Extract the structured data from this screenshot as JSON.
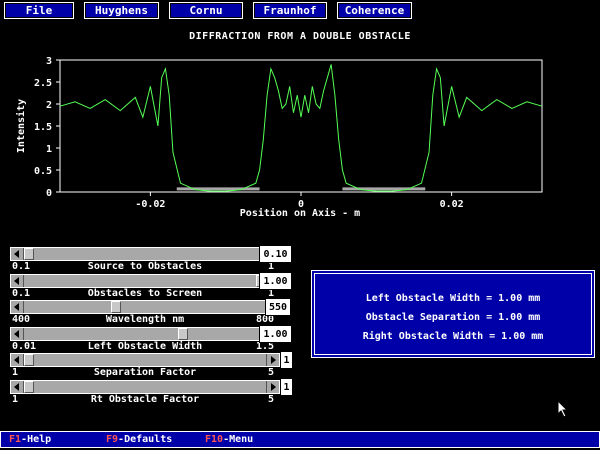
{
  "menu": [
    "File",
    "Huyghens",
    "Cornu",
    "Fraunhof",
    "Coherence"
  ],
  "chart_title": "DIFFRACTION FROM A DOUBLE OBSTACLE",
  "chart_data": {
    "type": "line",
    "title": "DIFFRACTION FROM A DOUBLE OBSTACLE",
    "xlabel": "Position on Axis - m",
    "ylabel": "Intensity",
    "xlim": [
      -0.032,
      0.032
    ],
    "ylim": [
      0,
      3
    ],
    "xticks": [
      -0.02,
      0,
      0.02
    ],
    "xtick_labels": [
      "-0.02",
      "0",
      "0.02"
    ],
    "yticks": [
      0,
      0.5,
      1,
      1.5,
      2,
      2.5,
      3
    ],
    "ytick_labels": [
      "0",
      "0.5",
      "1",
      "1.5",
      "2",
      "2.5",
      "3"
    ],
    "line_color": "#55ff55",
    "shadow_color": "#a8a8a8",
    "obstacle_shadows": [
      [
        -0.0165,
        -0.0055
      ],
      [
        0.0055,
        0.0165
      ]
    ],
    "series": [
      {
        "x": [
          -0.032,
          -0.03,
          -0.028,
          -0.026,
          -0.024,
          -0.022,
          -0.021,
          -0.02,
          -0.019,
          -0.0185,
          -0.018,
          -0.0175,
          -0.017,
          -0.016,
          -0.014,
          -0.012,
          -0.01,
          -0.008,
          -0.006,
          -0.0055,
          -0.005,
          -0.0045,
          -0.004,
          -0.0035,
          -0.003,
          -0.0025,
          -0.002,
          -0.0015,
          -0.001,
          -0.0005,
          0,
          0.0005,
          0.001,
          0.0015,
          0.002,
          0.0025,
          0.003,
          0.0035,
          0.004,
          0.0045,
          0.005,
          0.0055,
          0.006,
          0.008,
          0.01,
          0.012,
          0.014,
          0.016,
          0.017,
          0.0175,
          0.018,
          0.0185,
          0.019,
          0.02,
          0.021,
          0.022,
          0.024,
          0.026,
          0.028,
          0.03,
          0.032
        ],
        "y": [
          1.95,
          2.05,
          1.9,
          2.1,
          1.85,
          2.15,
          1.7,
          2.4,
          1.5,
          2.6,
          2.8,
          2.2,
          0.9,
          0.2,
          0.05,
          0.02,
          0.02,
          0.05,
          0.2,
          0.5,
          1.2,
          2.2,
          2.8,
          2.6,
          2.3,
          1.9,
          2.0,
          2.4,
          1.8,
          2.2,
          1.7,
          2.2,
          1.8,
          2.4,
          2.0,
          1.9,
          2.3,
          2.6,
          2.9,
          2.2,
          1.2,
          0.5,
          0.2,
          0.05,
          0.02,
          0.02,
          0.05,
          0.2,
          0.9,
          2.2,
          2.8,
          2.6,
          1.5,
          2.4,
          1.7,
          2.15,
          1.85,
          2.1,
          1.9,
          2.05,
          1.95
        ]
      }
    ]
  },
  "sliders": [
    {
      "name": "Source to Obstacles",
      "min": "0.1",
      "max": "1",
      "value": "0.10",
      "pos": 0.0
    },
    {
      "name": "Obstacles to Screen",
      "min": "0.1",
      "max": "1",
      "value": "1.00",
      "pos": 1.0
    },
    {
      "name": "Wavelength nm",
      "min": "400",
      "max": "800",
      "value": "550",
      "pos": 0.375
    },
    {
      "name": "Left Obstacle Width",
      "min": "0.01",
      "max": "1.5",
      "value": "1.00",
      "pos": 0.664
    },
    {
      "name": "Separation Factor",
      "min": "1",
      "max": "5",
      "value": "1",
      "pos": 0.0
    },
    {
      "name": "Rt Obstacle Factor",
      "min": "1",
      "max": "5",
      "value": "1",
      "pos": 0.0
    }
  ],
  "info": {
    "left_width": "Left Obstacle Width = 1.00 mm",
    "separation": "Obstacle Separation = 1.00 mm",
    "right_width": "Right Obstacle Width = 1.00 mm"
  },
  "status": [
    {
      "key": "F1",
      "label": "-Help"
    },
    {
      "key": "F9",
      "label": "-Defaults"
    },
    {
      "key": "F10",
      "label": "-Menu"
    }
  ]
}
